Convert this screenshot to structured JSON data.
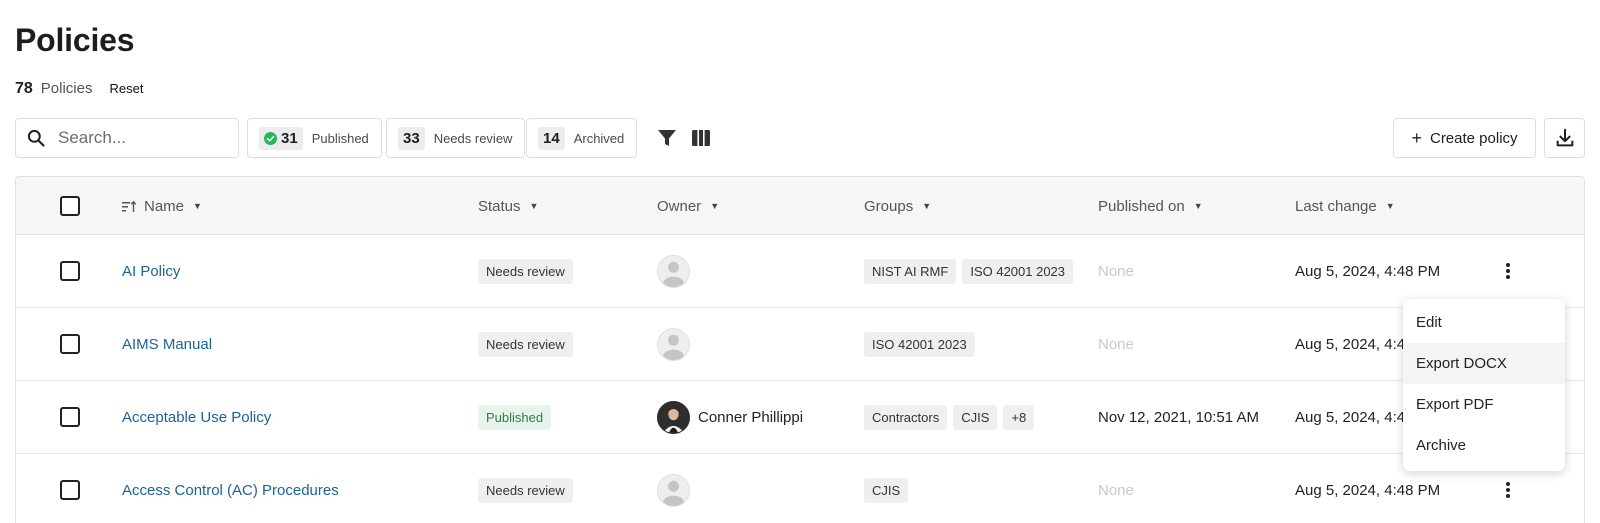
{
  "header": {
    "title": "Policies",
    "count": "78",
    "count_label": "Policies",
    "reset_label": "Reset"
  },
  "toolbar": {
    "search_placeholder": "Search...",
    "chips": [
      {
        "count": "31",
        "label": "Published",
        "icon": "check-circle-icon"
      },
      {
        "count": "33",
        "label": "Needs review"
      },
      {
        "count": "14",
        "label": "Archived"
      }
    ],
    "filter_icon": "filter-icon",
    "columns_icon": "columns-icon",
    "create_label": "Create policy",
    "download_icon": "download-icon"
  },
  "table": {
    "columns": [
      "Name",
      "Status",
      "Owner",
      "Groups",
      "Published on",
      "Last change"
    ],
    "rows": [
      {
        "name": "AI Policy",
        "status": "Needs review",
        "owner": "",
        "groups": [
          "NIST AI RMF",
          "ISO 42001 2023"
        ],
        "published_on": "None",
        "last_change": "Aug 5, 2024, 4:48 PM"
      },
      {
        "name": "AIMS Manual",
        "status": "Needs review",
        "owner": "",
        "groups": [
          "ISO 42001 2023"
        ],
        "published_on": "None",
        "last_change": "Aug 5, 2024, 4:48 PM"
      },
      {
        "name": "Acceptable Use Policy",
        "status": "Published",
        "owner": "Conner Phillippi",
        "groups": [
          "Contractors",
          "CJIS",
          "+8"
        ],
        "published_on": "Nov 12, 2021, 10:51 AM",
        "last_change": "Aug 5, 2024, 4:48 PM"
      },
      {
        "name": "Access Control (AC) Procedures",
        "status": "Needs review",
        "owner": "",
        "groups": [
          "CJIS"
        ],
        "published_on": "None",
        "last_change": "Aug 5, 2024, 4:48 PM"
      }
    ]
  },
  "context_menu": {
    "items": [
      "Edit",
      "Export DOCX",
      "Export PDF",
      "Archive"
    ],
    "hovered": "Export DOCX"
  },
  "colors": {
    "link": "#1a6496",
    "published_bg": "#e7f4ec",
    "published_text": "#2e7b4a",
    "check_green": "#22b85a"
  }
}
